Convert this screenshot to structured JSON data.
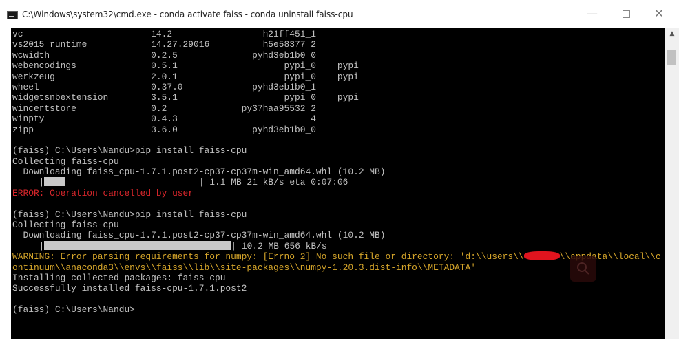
{
  "window": {
    "title": "C:\\Windows\\system32\\cmd.exe - conda  activate faiss - conda  uninstall faiss-cpu",
    "controls": {
      "minimize": "—",
      "close": "✕"
    }
  },
  "console": {
    "lines": [
      {
        "type": "normal",
        "text": "vc                        14.2                 h21ff451_1"
      },
      {
        "type": "normal",
        "text": "vs2015_runtime            14.27.29016          h5e58377_2"
      },
      {
        "type": "normal",
        "text": "wcwidth                   0.2.5              pyhd3eb1b0_0"
      },
      {
        "type": "normal",
        "text": "webencodings              0.5.1                    pypi_0    pypi"
      },
      {
        "type": "normal",
        "text": "werkzeug                  2.0.1                    pypi_0    pypi"
      },
      {
        "type": "normal",
        "text": "wheel                     0.37.0             pyhd3eb1b0_1"
      },
      {
        "type": "normal",
        "text": "widgetsnbextension        3.5.1                    pypi_0    pypi"
      },
      {
        "type": "normal",
        "text": "wincertstore              0.2              py37haa95532_2"
      },
      {
        "type": "normal",
        "text": "winpty                    0.4.3                         4"
      },
      {
        "type": "normal",
        "text": "zipp                      3.6.0              pyhd3eb1b0_0"
      },
      {
        "type": "normal",
        "text": ""
      },
      {
        "type": "normal",
        "text": "(faiss) C:\\Users\\Nandu>pip install faiss-cpu"
      },
      {
        "type": "normal",
        "text": "Collecting faiss-cpu"
      },
      {
        "type": "normal",
        "text": "  Downloading faiss_cpu-1.7.1.post2-cp37-cp37m-win_amd64.whl (10.2 MB)"
      },
      {
        "type": "progress1",
        "pre": "     |",
        "post": "                         | 1.1 MB 21 kB/s eta 0:07:06"
      },
      {
        "type": "error",
        "text": "ERROR: Operation cancelled by user"
      },
      {
        "type": "normal",
        "text": ""
      },
      {
        "type": "normal",
        "text": "(faiss) C:\\Users\\Nandu>pip install faiss-cpu"
      },
      {
        "type": "normal",
        "text": "Collecting faiss-cpu"
      },
      {
        "type": "normal",
        "text": "  Downloading faiss_cpu-1.7.1.post2-cp37-cp37m-win_amd64.whl (10.2 MB)"
      },
      {
        "type": "progress2",
        "pre": "     |",
        "post": "| 10.2 MB 656 kB/s"
      },
      {
        "type": "warning_split",
        "pre": "WARNING: Error parsing requirements for numpy: [Errno 2] No such file or directory: 'd:\\\\users\\\\",
        "post": "\\\\appdata\\\\local\\\\c"
      },
      {
        "type": "warning",
        "text": "ontinuum\\\\anaconda3\\\\envs\\\\faiss\\\\lib\\\\site-packages\\\\numpy-1.20.3.dist-info\\\\METADATA'"
      },
      {
        "type": "normal",
        "text": "Installing collected packages: faiss-cpu"
      },
      {
        "type": "normal",
        "text": "Successfully installed faiss-cpu-1.7.1.post2"
      },
      {
        "type": "normal",
        "text": ""
      },
      {
        "type": "normal",
        "text": "(faiss) C:\\Users\\Nandu>"
      }
    ]
  },
  "colors": {
    "console_bg": "#000000",
    "console_text": "#c0c0c0",
    "error": "#d9262b",
    "warning": "#d5a52a"
  }
}
